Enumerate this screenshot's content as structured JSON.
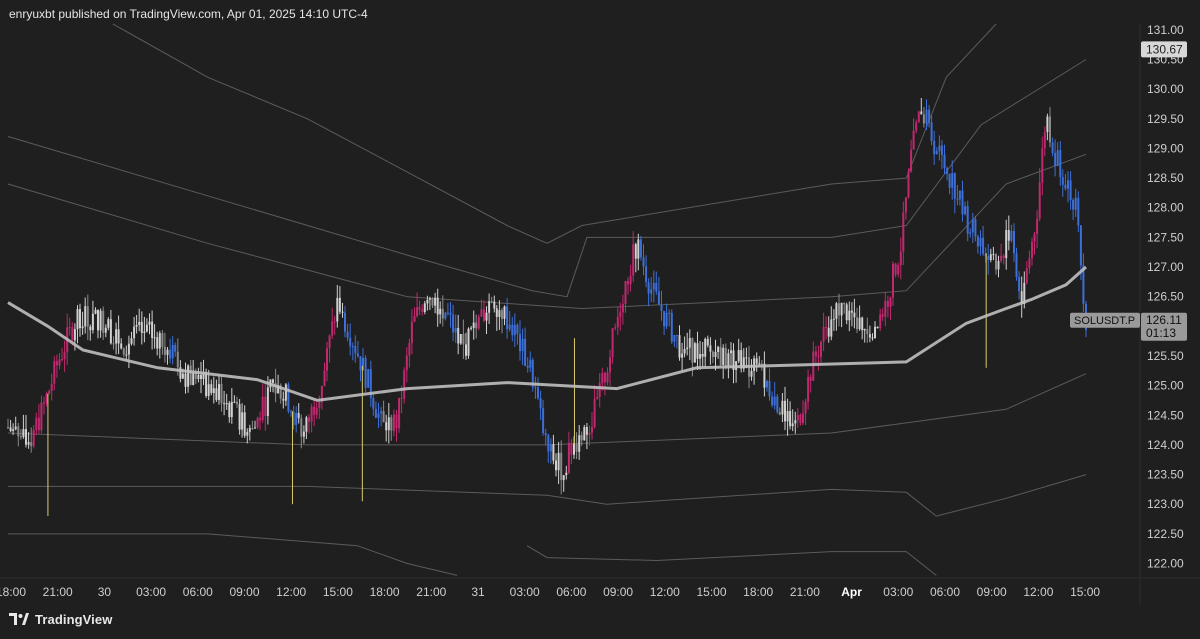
{
  "header": {
    "publish_line": "enryuxbt published on TradingView.com, Apr 01, 2025 14:10 UTC-4"
  },
  "footer": {
    "brand": "TradingView",
    "brand_icon": "tradingview-logo-icon"
  },
  "colors": {
    "background": "#1f1f1f",
    "bull_candle": "#d0d0d0",
    "bear_candle": "#3d6fd6",
    "momentum_candle": "#c2286f",
    "wick_highlight": "#d9cc6a",
    "vwap_line": "#bfbfbf",
    "band_line": "#707070",
    "price_label_bg": "#9a9a9a",
    "top_label_bg": "#d8d8d8"
  },
  "chart_data": {
    "type": "candlestick",
    "symbol_label": "SOLUSDT.P",
    "last_price": "126.11",
    "countdown": "01:13",
    "top_price_label": "130.67",
    "y_axis_ticks": [
      "131.00",
      "130.50",
      "130.00",
      "129.50",
      "129.00",
      "128.50",
      "128.00",
      "127.50",
      "127.00",
      "126.50",
      "126.00",
      "125.50",
      "125.00",
      "124.50",
      "124.00",
      "123.50",
      "123.00",
      "122.50",
      "122.00"
    ],
    "ylim": [
      121.75,
      131.2
    ],
    "x_axis_ticks": [
      "18:00",
      "21:00",
      "30",
      "03:00",
      "06:00",
      "09:00",
      "12:00",
      "15:00",
      "18:00",
      "21:00",
      "31",
      "03:00",
      "06:00",
      "09:00",
      "12:00",
      "15:00",
      "18:00",
      "21:00",
      "Apr",
      "03:00",
      "06:00",
      "09:00",
      "12:00",
      "15:00"
    ],
    "x_axis_bold_ticks": [
      "Apr"
    ],
    "price_path": [
      {
        "t": 0,
        "p": 124.3
      },
      {
        "t": 4,
        "p": 124.0
      },
      {
        "t": 7,
        "p": 124.6
      },
      {
        "t": 10,
        "p": 125.4
      },
      {
        "t": 14,
        "p": 126.2
      },
      {
        "t": 19,
        "p": 126.1
      },
      {
        "t": 23,
        "p": 125.7
      },
      {
        "t": 27,
        "p": 125.9
      },
      {
        "t": 31,
        "p": 125.8
      },
      {
        "t": 35,
        "p": 125.2
      },
      {
        "t": 40,
        "p": 125.0
      },
      {
        "t": 45,
        "p": 124.6
      },
      {
        "t": 49,
        "p": 124.2
      },
      {
        "t": 53,
        "p": 125.0
      },
      {
        "t": 56,
        "p": 124.8
      },
      {
        "t": 59,
        "p": 124.1
      },
      {
        "t": 63,
        "p": 125.1
      },
      {
        "t": 66,
        "p": 126.4
      },
      {
        "t": 69,
        "p": 125.8
      },
      {
        "t": 72,
        "p": 125.1
      },
      {
        "t": 75,
        "p": 124.3
      },
      {
        "t": 78,
        "p": 124.4
      },
      {
        "t": 81,
        "p": 126.0
      },
      {
        "t": 84,
        "p": 126.6
      },
      {
        "t": 88,
        "p": 126.2
      },
      {
        "t": 91,
        "p": 125.6
      },
      {
        "t": 94,
        "p": 126.0
      },
      {
        "t": 97,
        "p": 126.5
      },
      {
        "t": 101,
        "p": 126.0
      },
      {
        "t": 105,
        "p": 125.2
      },
      {
        "t": 108,
        "p": 123.9
      },
      {
        "t": 111,
        "p": 123.6
      },
      {
        "t": 114,
        "p": 124.1
      },
      {
        "t": 117,
        "p": 124.4
      },
      {
        "t": 120,
        "p": 125.3
      },
      {
        "t": 123,
        "p": 126.5
      },
      {
        "t": 126,
        "p": 127.4
      },
      {
        "t": 129,
        "p": 126.6
      },
      {
        "t": 132,
        "p": 126.1
      },
      {
        "t": 135,
        "p": 125.6
      },
      {
        "t": 139,
        "p": 125.6
      },
      {
        "t": 143,
        "p": 125.5
      },
      {
        "t": 147,
        "p": 125.4
      },
      {
        "t": 151,
        "p": 125.2
      },
      {
        "t": 155,
        "p": 124.6
      },
      {
        "t": 158,
        "p": 124.3
      },
      {
        "t": 161,
        "p": 125.3
      },
      {
        "t": 164,
        "p": 126.0
      },
      {
        "t": 167,
        "p": 126.3
      },
      {
        "t": 170,
        "p": 126.1
      },
      {
        "t": 173,
        "p": 125.9
      },
      {
        "t": 176,
        "p": 126.4
      },
      {
        "t": 179,
        "p": 127.4
      },
      {
        "t": 181,
        "p": 128.9
      },
      {
        "t": 183,
        "p": 129.7
      },
      {
        "t": 186,
        "p": 129.0
      },
      {
        "t": 189,
        "p": 128.5
      },
      {
        "t": 192,
        "p": 127.8
      },
      {
        "t": 195,
        "p": 127.4
      },
      {
        "t": 198,
        "p": 126.9
      },
      {
        "t": 201,
        "p": 127.7
      },
      {
        "t": 203,
        "p": 126.4
      },
      {
        "t": 206,
        "p": 127.8
      },
      {
        "t": 208,
        "p": 129.6
      },
      {
        "t": 210,
        "p": 128.8
      },
      {
        "t": 212,
        "p": 128.5
      },
      {
        "t": 214,
        "p": 128.0
      },
      {
        "t": 216,
        "p": 126.1
      }
    ],
    "vwap_path": [
      {
        "t": 0,
        "p": 126.4
      },
      {
        "t": 8,
        "p": 126.0
      },
      {
        "t": 15,
        "p": 125.6
      },
      {
        "t": 30,
        "p": 125.3
      },
      {
        "t": 50,
        "p": 125.1
      },
      {
        "t": 62,
        "p": 124.75
      },
      {
        "t": 80,
        "p": 124.95
      },
      {
        "t": 100,
        "p": 125.05
      },
      {
        "t": 122,
        "p": 124.95
      },
      {
        "t": 138,
        "p": 125.3
      },
      {
        "t": 160,
        "p": 125.35
      },
      {
        "t": 180,
        "p": 125.4
      },
      {
        "t": 192,
        "p": 126.05
      },
      {
        "t": 200,
        "p": 126.3
      },
      {
        "t": 205,
        "p": 126.45
      },
      {
        "t": 212,
        "p": 126.7
      },
      {
        "t": 216,
        "p": 127.0
      }
    ],
    "band_lines": [
      [
        {
          "t": 21,
          "p": 131.1
        },
        {
          "t": 40,
          "p": 130.2
        },
        {
          "t": 60,
          "p": 129.5
        },
        {
          "t": 80,
          "p": 128.6
        },
        {
          "t": 100,
          "p": 127.7
        },
        {
          "t": 108,
          "p": 127.4
        },
        {
          "t": 115,
          "p": 127.7
        },
        {
          "t": 165,
          "p": 128.4
        },
        {
          "t": 180,
          "p": 128.5
        },
        {
          "t": 188,
          "p": 130.2
        },
        {
          "t": 198,
          "p": 131.1
        }
      ],
      [
        {
          "t": 0,
          "p": 129.2
        },
        {
          "t": 40,
          "p": 128.2
        },
        {
          "t": 80,
          "p": 127.2
        },
        {
          "t": 105,
          "p": 126.6
        },
        {
          "t": 112,
          "p": 126.5
        },
        {
          "t": 116,
          "p": 127.5
        },
        {
          "t": 165,
          "p": 127.5
        },
        {
          "t": 180,
          "p": 127.7
        },
        {
          "t": 195,
          "p": 129.4
        },
        {
          "t": 216,
          "p": 130.5
        }
      ],
      [
        {
          "t": 0,
          "p": 128.4
        },
        {
          "t": 40,
          "p": 127.4
        },
        {
          "t": 80,
          "p": 126.5
        },
        {
          "t": 115,
          "p": 126.3
        },
        {
          "t": 165,
          "p": 126.5
        },
        {
          "t": 180,
          "p": 126.6
        },
        {
          "t": 200,
          "p": 128.4
        },
        {
          "t": 216,
          "p": 128.9
        }
      ],
      [
        {
          "t": 0,
          "p": 124.2
        },
        {
          "t": 60,
          "p": 124.0
        },
        {
          "t": 108,
          "p": 124.0
        },
        {
          "t": 165,
          "p": 124.2
        },
        {
          "t": 200,
          "p": 124.6
        },
        {
          "t": 216,
          "p": 125.2
        }
      ],
      [
        {
          "t": 0,
          "p": 123.3
        },
        {
          "t": 60,
          "p": 123.3
        },
        {
          "t": 108,
          "p": 123.15
        },
        {
          "t": 120,
          "p": 123.0
        },
        {
          "t": 165,
          "p": 123.25
        },
        {
          "t": 180,
          "p": 123.2
        },
        {
          "t": 186,
          "p": 122.8
        },
        {
          "t": 200,
          "p": 123.1
        },
        {
          "t": 216,
          "p": 123.5
        }
      ],
      [
        {
          "t": 0,
          "p": 122.5
        },
        {
          "t": 40,
          "p": 122.5
        },
        {
          "t": 70,
          "p": 122.3
        },
        {
          "t": 80,
          "p": 122.0
        },
        {
          "t": 90,
          "p": 121.8
        }
      ],
      [
        {
          "t": 104,
          "p": 122.3
        },
        {
          "t": 108,
          "p": 122.1
        },
        {
          "t": 130,
          "p": 122.05
        },
        {
          "t": 165,
          "p": 122.2
        },
        {
          "t": 180,
          "p": 122.2
        },
        {
          "t": 186,
          "p": 121.8
        }
      ]
    ]
  }
}
